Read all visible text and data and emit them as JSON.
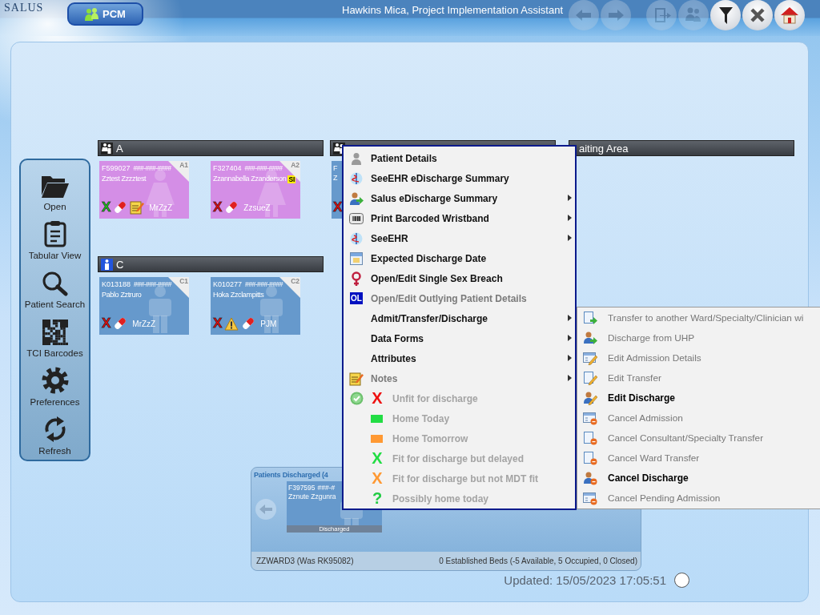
{
  "app": {
    "logo": "SALUS",
    "module_button": "PCM",
    "user_title": "Hawkins Mica, Project Implementation Assistant",
    "toolbar_buttons": [
      {
        "kind": "back",
        "disabled": true
      },
      {
        "kind": "forward",
        "disabled": true
      },
      {
        "kind": "exit",
        "disabled": true
      },
      {
        "kind": "users",
        "disabled": true
      },
      {
        "kind": "filter",
        "disabled": false
      },
      {
        "kind": "close",
        "disabled": false
      },
      {
        "kind": "home",
        "disabled": false
      }
    ]
  },
  "sidebar": {
    "items": [
      {
        "kind": "open",
        "label": "Open"
      },
      {
        "kind": "tabular",
        "label": "Tabular View"
      },
      {
        "kind": "search",
        "label": "Patient Search"
      },
      {
        "kind": "barcodes",
        "label": "TCI Barcodes"
      },
      {
        "kind": "preferences",
        "label": "Preferences"
      },
      {
        "kind": "refresh",
        "label": "Refresh"
      }
    ]
  },
  "bays": [
    {
      "kind": "mixed",
      "name": "A",
      "cards": [
        {
          "id": "F599027",
          "nhs": "###-###-####",
          "name": "Zztest Zzzztest",
          "bed": "A1",
          "kind": "female",
          "status": {
            "marker": "X",
            "color": "#22cc22"
          },
          "medication": true,
          "alert": false,
          "notes": true,
          "clinician": "MrZzZ"
        },
        {
          "id": "F327404",
          "nhs": "###-###-####",
          "name": "Zzannabella Zzanderson",
          "badge": "SI",
          "bed": "A2",
          "kind": "female",
          "status": {
            "marker": "X",
            "color": "#ee1111"
          },
          "medication": true,
          "alert": false,
          "notes": false,
          "clinician": "ZzsueZ"
        }
      ]
    },
    {
      "kind": "mixed",
      "cards": [
        {
          "id": "F",
          "name": "Z",
          "kind": "male",
          "status": {
            "marker": "X",
            "color": "#ee1111"
          }
        }
      ]
    },
    {
      "kind": "waiting",
      "name": "aiting Area"
    },
    {
      "kind": "male",
      "name": "C",
      "cards": [
        {
          "id": "K013188",
          "nhs": "###-###-####",
          "name": "Pablo Zztruro",
          "bed": "C1",
          "kind": "male",
          "status": {
            "marker": "X",
            "color": "#ee1111"
          },
          "medication": true,
          "alert": false,
          "notes": false,
          "clinician": "MrZzZ"
        },
        {
          "id": "K010277",
          "nhs": "###-###-####",
          "name": "Hoka Zzclampitts",
          "bed": "C2",
          "kind": "male",
          "status": {
            "marker": "X",
            "color": "#ee1111"
          },
          "medication": true,
          "alert": true,
          "notes": false,
          "clinician": "PJM"
        }
      ]
    }
  ],
  "discharged": {
    "title": "Patients Discharged (4",
    "card": {
      "id": "F397595",
      "nhs": "###-#",
      "name": "Zznute Zzgunra",
      "status_label": "Discharged"
    },
    "ward": "ZZWARD3 (Was RK95082)",
    "beds": "0 Established Beds (-5 Available, 5 Occupied, 0 Closed)"
  },
  "updated": "Updated: 15/05/2023 17:05:51",
  "context_menu": {
    "items": [
      {
        "kind": "action",
        "label": "Patient Details",
        "disabled": false,
        "submenu": false
      },
      {
        "kind": "action",
        "label": "SeeEHR eDischarge Summary",
        "disabled": false,
        "submenu": false
      },
      {
        "kind": "action",
        "label": "Salus eDischarge Summary",
        "disabled": false,
        "submenu": true
      },
      {
        "kind": "action",
        "label": "Print Barcoded Wristband",
        "disabled": false,
        "submenu": true
      },
      {
        "kind": "action",
        "label": "SeeEHR",
        "disabled": false,
        "submenu": true
      },
      {
        "kind": "action",
        "label": "Expected Discharge Date",
        "disabled": false,
        "submenu": false
      },
      {
        "kind": "action",
        "label": "Open/Edit Single Sex Breach",
        "disabled": false,
        "submenu": false
      },
      {
        "kind": "action",
        "label": "Open/Edit Outlying Patient Details",
        "badge": "OL",
        "disabled": true,
        "submenu": false
      },
      {
        "kind": "action",
        "label": "Admit/Transfer/Discharge",
        "disabled": false,
        "submenu": true
      },
      {
        "kind": "action",
        "label": "Data Forms",
        "disabled": false,
        "submenu": true
      },
      {
        "kind": "action",
        "label": "Attributes",
        "disabled": false,
        "submenu": true
      },
      {
        "kind": "action",
        "label": "Notes",
        "disabled": true,
        "submenu": true
      },
      {
        "kind": "status",
        "label": "Unfit for discharge",
        "marker": "X",
        "color": "#ee1111",
        "checked": true,
        "disabled": true
      },
      {
        "kind": "status",
        "label": "Home Today",
        "color": "#22dd44",
        "checked": false,
        "disabled": true
      },
      {
        "kind": "status",
        "label": "Home Tomorrow",
        "color": "#ff9933",
        "checked": false,
        "disabled": true
      },
      {
        "kind": "status",
        "label": "Fit for discharge but delayed",
        "marker": "X",
        "color": "#22dd44",
        "checked": false,
        "disabled": true
      },
      {
        "kind": "status",
        "label": "Fit for discharge but not MDT fit",
        "marker": "X",
        "color": "#ff9933",
        "checked": false,
        "disabled": true
      },
      {
        "kind": "status",
        "label": "Possibly home today",
        "marker": "?",
        "color": "#22cc44",
        "checked": false,
        "disabled": true
      }
    ]
  },
  "submenu": {
    "items": [
      {
        "label": "Transfer to another Ward/Specialty/Clinician wi",
        "disabled": true
      },
      {
        "label": "Discharge from UHP",
        "disabled": true
      },
      {
        "label": "Edit Admission Details",
        "disabled": true
      },
      {
        "label": "Edit Transfer",
        "disabled": true
      },
      {
        "label": "Edit Discharge",
        "disabled": false
      },
      {
        "label": "Cancel Admission",
        "disabled": true
      },
      {
        "label": "Cancel Consultant/Specialty Transfer",
        "disabled": true
      },
      {
        "label": "Cancel Ward Transfer",
        "disabled": true
      },
      {
        "label": "Cancel Discharge",
        "disabled": false
      },
      {
        "label": "Cancel Pending Admission",
        "disabled": true
      }
    ]
  }
}
